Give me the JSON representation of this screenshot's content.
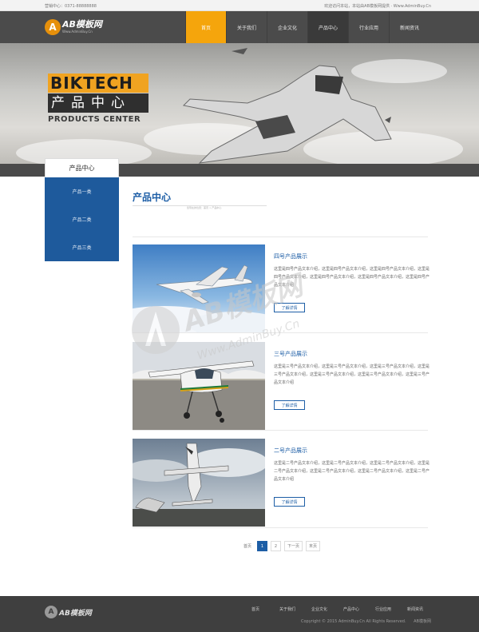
{
  "topbar": {
    "hotline": "营销中心：0371-88888888",
    "welcome": "欢迎访问本站，本站由AB模板网提供 · Www.AdminBuy.Cn"
  },
  "header": {
    "logo_mark": "A",
    "logo_name": "AB模板网",
    "logo_sub": "Www.AdminBuy.Cn",
    "nav": [
      {
        "label": "首页"
      },
      {
        "label": "关于我们"
      },
      {
        "label": "企业文化"
      },
      {
        "label": "产品中心"
      },
      {
        "label": "行业应用"
      },
      {
        "label": "新闻资讯"
      }
    ]
  },
  "banner": {
    "brand": "BIKTECH",
    "cn_title": "产品中心",
    "en_title": "PRODUCTS CENTER"
  },
  "sidebar": {
    "title": "产品中心",
    "items": [
      {
        "label": "产品一类"
      },
      {
        "label": "产品二类"
      },
      {
        "label": "产品三类"
      }
    ]
  },
  "main": {
    "heading": "产品中心",
    "breadcrumb": "您现在的位置：首页 > 产品中心"
  },
  "products": [
    {
      "title": "四号产品展示",
      "desc": "这里是四号产品文本介绍，这里是四号产品文本介绍，这里是四号产品文本介绍，这里是四号产品文本介绍，这里是四号产品文本介绍，这里是四号产品文本介绍，这里是四号产品文本介绍",
      "more": "了解详情",
      "image_icon": "airliner-photo"
    },
    {
      "title": "三号产品展示",
      "desc": "这里是三号产品文本介绍，这里是三号产品文本介绍，这里是三号产品文本介绍，这里是三号产品文本介绍，这里是三号产品文本介绍，这里是三号产品文本介绍，这里是三号产品文本介绍",
      "more": "了解详情",
      "image_icon": "light-aircraft-photo"
    },
    {
      "title": "二号产品展示",
      "desc": "这里是二号产品文本介绍，这里是二号产品文本介绍，这里是二号产品文本介绍，这里是二号产品文本介绍，这里是二号产品文本介绍，这里是二号产品文本介绍，这里是二号产品文本介绍",
      "more": "了解详情",
      "image_icon": "aerobatic-aircraft-photo"
    }
  ],
  "pager": {
    "first": "首页",
    "pages": [
      "1",
      "2"
    ],
    "current": "1",
    "next": "下一页",
    "last": "末页"
  },
  "footer": {
    "logo_mark": "A",
    "logo_name": "AB模板网",
    "nav": [
      {
        "label": "首页"
      },
      {
        "label": "关于我们"
      },
      {
        "label": "企业文化"
      },
      {
        "label": "产品中心"
      },
      {
        "label": "行业应用"
      },
      {
        "label": "新闻资讯"
      }
    ],
    "copyright": "Copyright © 2015 AdminBuy.Cn All Rights Reserved.",
    "credit": "AB模板网"
  },
  "watermark": {
    "text_cn": "AB模板网",
    "text_en": "Www.AdminBuy.Cn"
  },
  "colors": {
    "accent_orange": "#f5a50c",
    "brand_blue": "#1d5ea6",
    "header_dark": "#4b4b4b"
  }
}
